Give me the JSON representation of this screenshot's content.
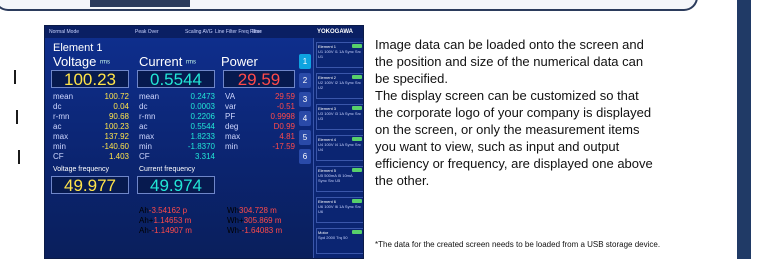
{
  "screen": {
    "status_bar": {
      "mode": "Normal Mode",
      "peak_over": "Peak Over",
      "scaling": "Scaling AVG",
      "line_filter": "Line Filter Freq Filter",
      "time": "Time",
      "brand": "YOKOGAWA"
    },
    "element_title": "Element 1",
    "voltage": {
      "label": "Voltage",
      "unit_suffix": "rms",
      "value": "100.23",
      "rows": [
        {
          "label": "mean",
          "value": "100.72"
        },
        {
          "label": "dc",
          "value": "0.04"
        },
        {
          "label": "r-mn",
          "value": "90.68"
        },
        {
          "label": "ac",
          "value": "100.23"
        },
        {
          "label": "max",
          "value": "137.92"
        },
        {
          "label": "min",
          "value": "-140.60"
        },
        {
          "label": "CF",
          "value": "1.403"
        }
      ]
    },
    "current": {
      "label": "Current",
      "unit_suffix": "rms",
      "value": "0.5544",
      "rows": [
        {
          "label": "mean",
          "value": "0.2473"
        },
        {
          "label": "dc",
          "value": "0.0003"
        },
        {
          "label": "r-mn",
          "value": "0.2206"
        },
        {
          "label": "ac",
          "value": "0.5544"
        },
        {
          "label": "max",
          "value": "1.8233"
        },
        {
          "label": "min",
          "value": "-1.8370"
        },
        {
          "label": "CF",
          "value": "3.314"
        }
      ]
    },
    "power": {
      "label": "Power",
      "value": "29.59",
      "rows": [
        {
          "label": "VA",
          "value": "29.59"
        },
        {
          "label": "var",
          "value": "-0.51"
        },
        {
          "label": "PF",
          "value": "0.9998"
        },
        {
          "label": "deg",
          "value": "D0.99"
        },
        {
          "label": "max",
          "value": "4.81"
        },
        {
          "label": "min",
          "value": "-17.59"
        }
      ]
    },
    "voltage_frequency": {
      "label": "Voltage frequency",
      "value": "49.977"
    },
    "current_frequency": {
      "label": "Current frequency",
      "value": "49.974"
    },
    "ah_rows": [
      {
        "label": "Ah",
        "value": "-3.54162 p"
      },
      {
        "label": "Ah+",
        "value": "1.14653 m"
      },
      {
        "label": "Ah-",
        "value": "-1.14907 m"
      }
    ],
    "wh_rows": [
      {
        "label": "Wh",
        "value": "304.728 m"
      },
      {
        "label": "Wh+",
        "value": "305.869 m"
      },
      {
        "label": "Wh-",
        "value": "-1.64083 m"
      }
    ],
    "side_tabs": [
      "1",
      "2",
      "3",
      "4",
      "5",
      "6"
    ],
    "side_panel": [
      {
        "name": "Element 1",
        "lines": "U1 100V  I1 1A  Sync Src U1"
      },
      {
        "name": "Element 2",
        "lines": "U2 100V  I2 1A  Sync Src U2"
      },
      {
        "name": "Element 3",
        "lines": "U3 100V  I3 1A  Sync Src U3"
      },
      {
        "name": "Element 4",
        "lines": "U4 100V  I4 1A  Sync Src U4"
      },
      {
        "name": "Element 5",
        "lines": "U5 500mA  I5 10mA  Sync Src U5"
      },
      {
        "name": "Element 6",
        "lines": "U6 100V  I6 1A  Sync Src U6"
      },
      {
        "name": "Motor",
        "lines": "Spd 2000  Trq 50"
      }
    ],
    "colors": {
      "voltage": "#ffe44a",
      "current": "#22e6d6",
      "power": "#ff4a4a"
    }
  },
  "description": {
    "lines": [
      "Image data can be loaded onto the screen and",
      "the position and size of the numerical data can",
      "be specified.",
      "The display screen can be customized so that",
      "the corporate logo of your company is displayed",
      "on the screen, or only the measurement items",
      "you want to view, such as input and output",
      "efficiency or frequency, are displayed one above",
      "the other."
    ],
    "note": "*The data for the created screen needs to be loaded from a USB storage device."
  }
}
